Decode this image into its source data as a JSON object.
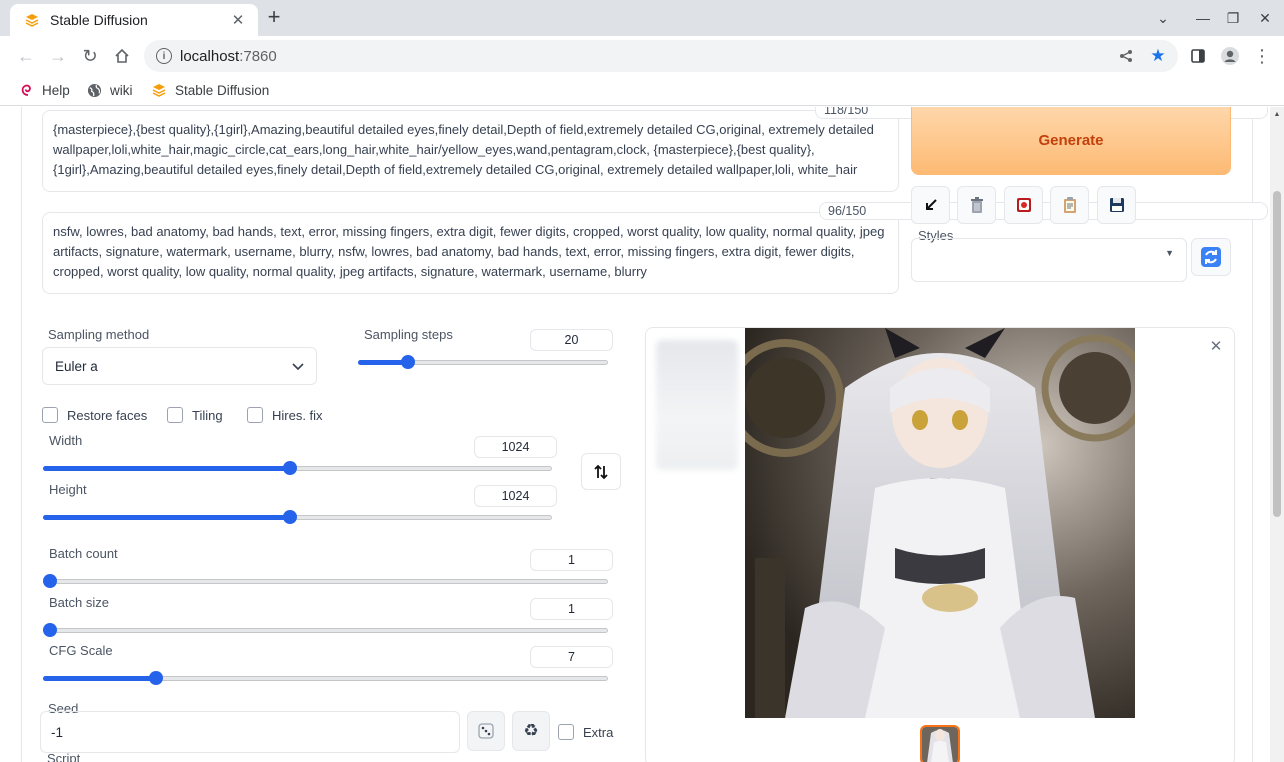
{
  "browser": {
    "tab_title": "Stable Diffusion",
    "url_host": "localhost",
    "url_port": ":7860",
    "bookmarks": [
      "Help",
      "wiki",
      "Stable Diffusion"
    ]
  },
  "prompt": {
    "counter": "118/150",
    "text": "{masterpiece},{best quality},{1girl},Amazing,beautiful detailed eyes,finely detail,Depth of field,extremely detailed CG,original, extremely detailed wallpaper,loli,white_hair,magic_circle,cat_ears,long_hair,white_hair/yellow_eyes,wand,pentagram,clock, {masterpiece},{best quality},{1girl},Amazing,beautiful detailed eyes,finely detail,Depth of field,extremely detailed CG,original, extremely detailed wallpaper,loli, white_hair"
  },
  "negative_prompt": {
    "counter": "96/150",
    "text": "nsfw, lowres, bad anatomy, bad hands, text, error, missing fingers, extra digit, fewer digits, cropped, worst quality, low quality, normal quality, jpeg artifacts, signature, watermark, username, blurry, nsfw, lowres, bad anatomy, bad hands, text, error, missing fingers, extra digit, fewer digits, cropped, worst quality, low quality, normal quality, jpeg artifacts, signature, watermark, username, blurry"
  },
  "actions": {
    "generate_label": "Generate",
    "styles_label": "Styles"
  },
  "settings": {
    "sampling_method_label": "Sampling method",
    "sampling_method_value": "Euler a",
    "sampling_steps_label": "Sampling steps",
    "sampling_steps_value": "20",
    "sampling_steps_fraction": 0.2,
    "checkboxes": [
      "Restore faces",
      "Tiling",
      "Hires. fix"
    ],
    "width_label": "Width",
    "width_value": "1024",
    "width_fraction": 0.485,
    "height_label": "Height",
    "height_value": "1024",
    "height_fraction": 0.485,
    "batch_count_label": "Batch count",
    "batch_count_value": "1",
    "batch_count_fraction": 0,
    "batch_size_label": "Batch size",
    "batch_size_value": "1",
    "batch_size_fraction": 0,
    "cfg_label": "CFG Scale",
    "cfg_value": "7",
    "cfg_fraction": 0.2,
    "seed_label": "Seed",
    "seed_value": "-1",
    "extra_label": "Extra",
    "script_label": "Script"
  },
  "colors": {
    "accent": "#2563eb",
    "generate": "#fdba74",
    "generate_text": "#c2410c"
  }
}
